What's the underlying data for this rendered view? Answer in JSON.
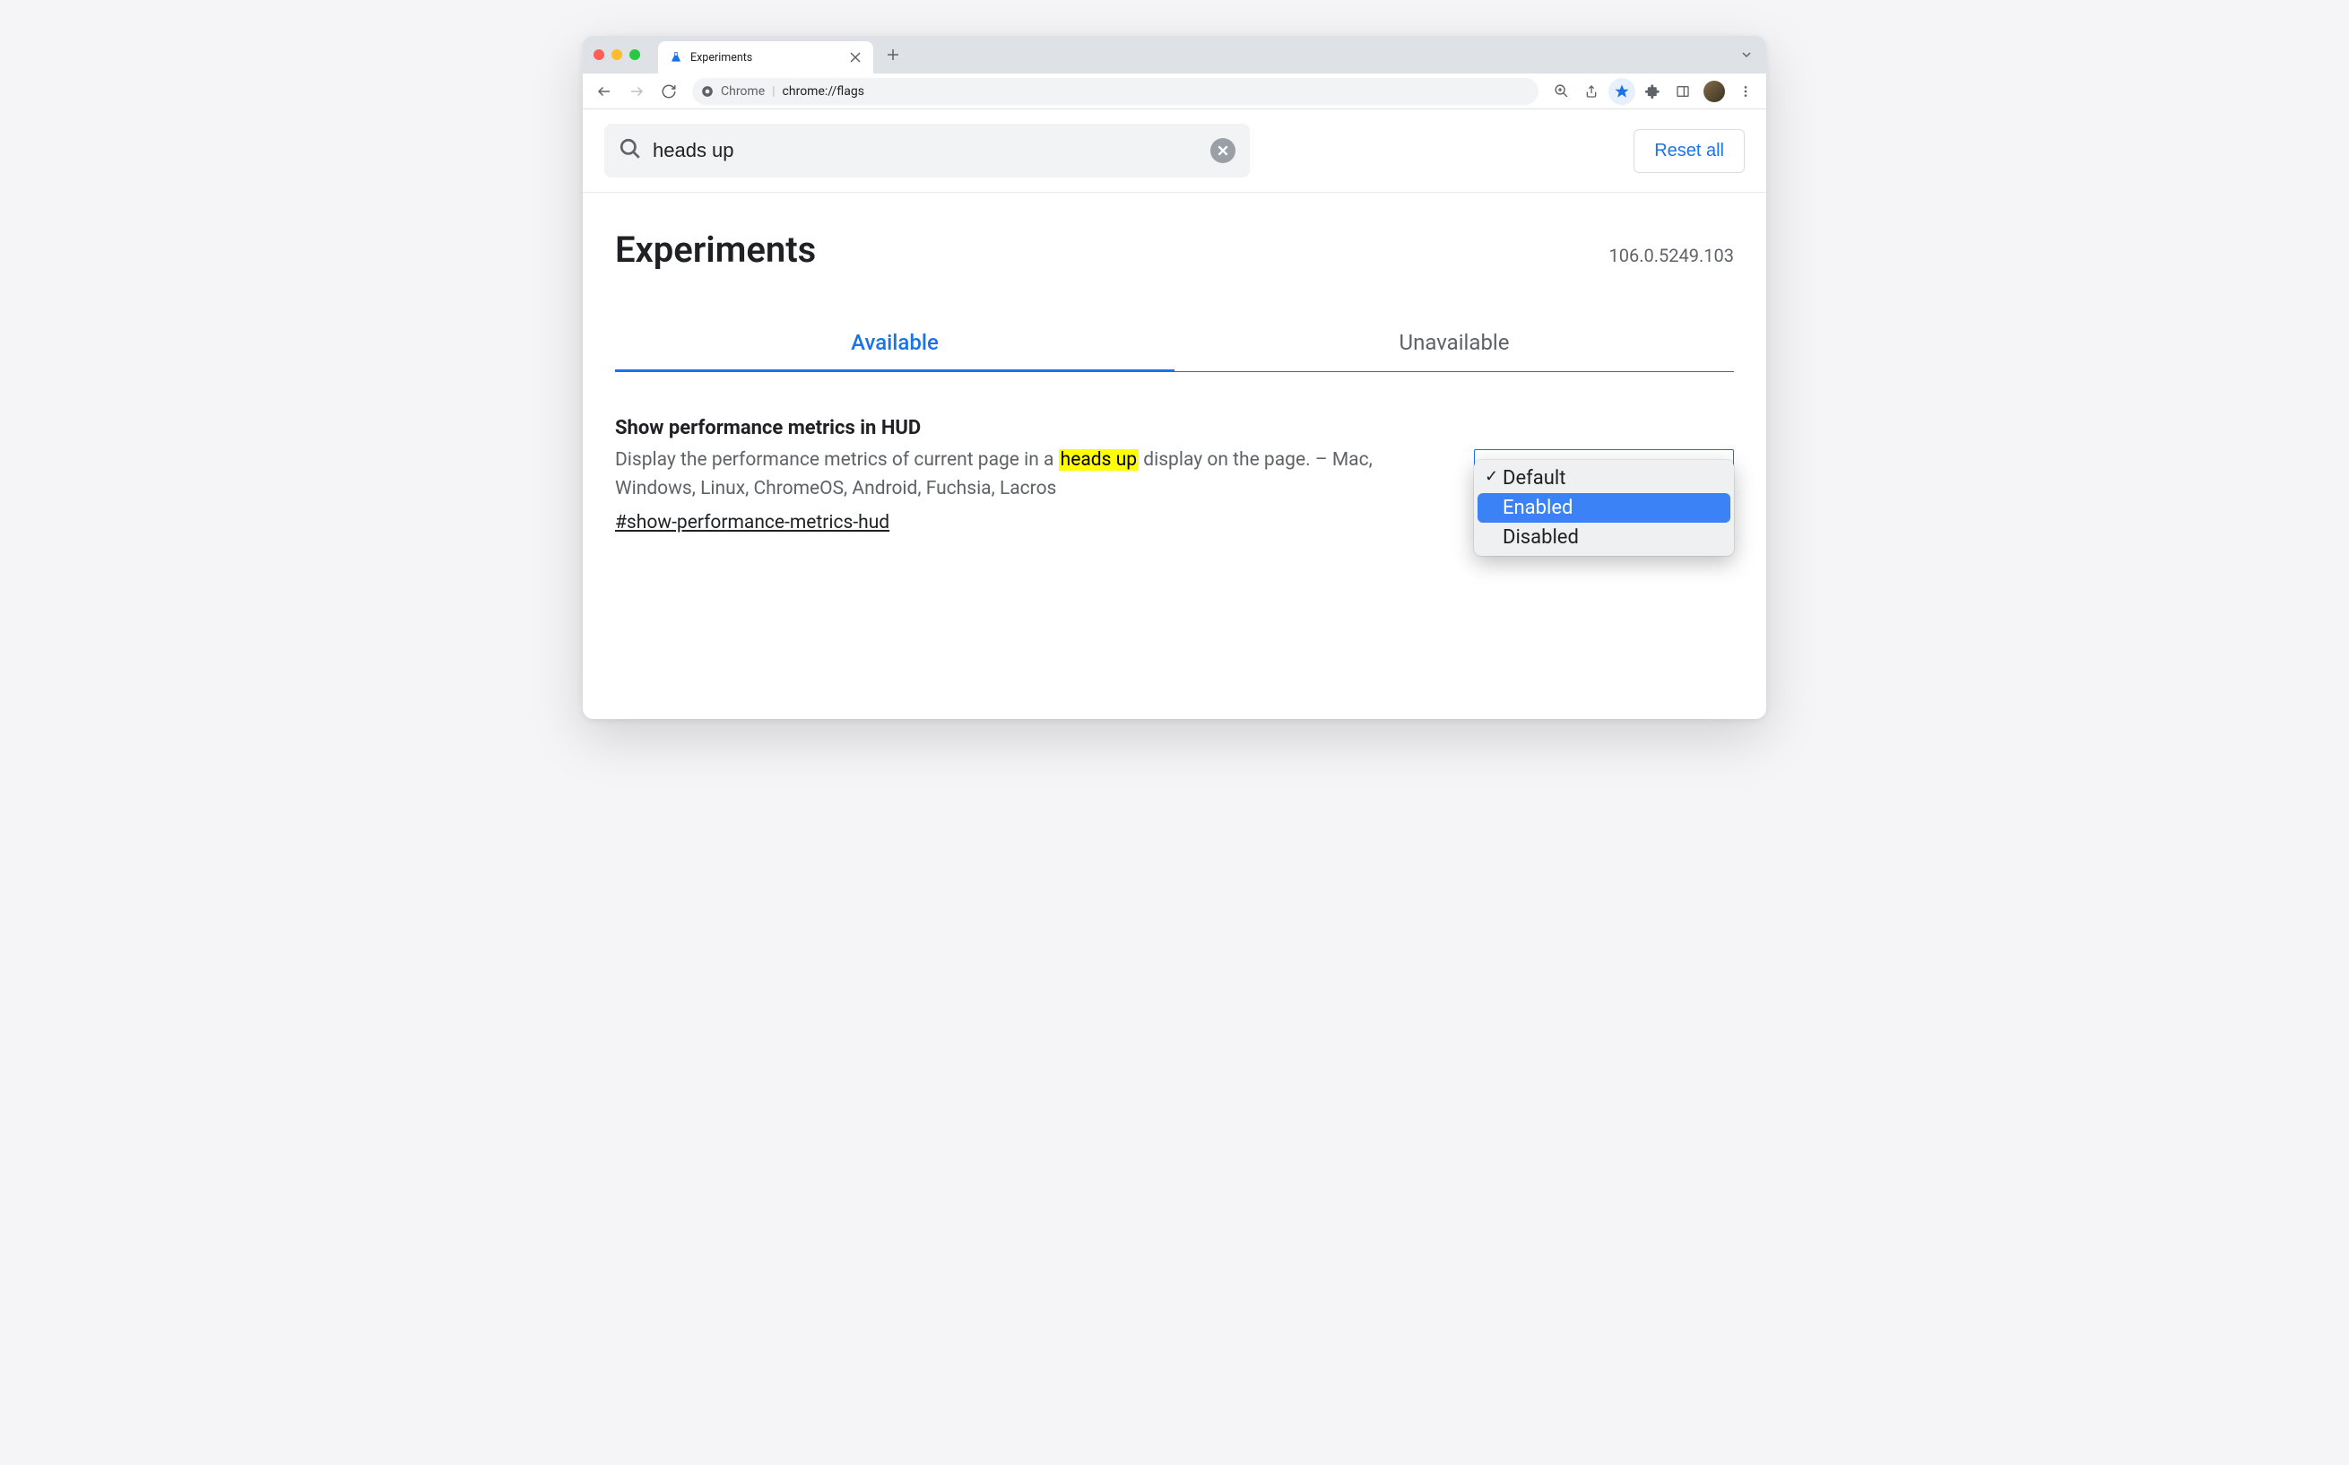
{
  "window": {
    "tab": {
      "title": "Experiments"
    }
  },
  "toolbar": {
    "omnibox_label": "Chrome",
    "omnibox_url": "chrome://flags"
  },
  "search": {
    "value": "heads up",
    "reset_label": "Reset all"
  },
  "header": {
    "title": "Experiments",
    "version": "106.0.5249.103"
  },
  "tabs": {
    "available": "Available",
    "unavailable": "Unavailable"
  },
  "experiment": {
    "title": "Show performance metrics in HUD",
    "desc_before": "Display the performance metrics of current page in a ",
    "desc_highlight": "heads up",
    "desc_after": " display on the page. – Mac, Windows, Linux, ChromeOS, Android, Fuchsia, Lacros",
    "hash": "#show-performance-metrics-hud"
  },
  "dropdown": {
    "options": {
      "default": "Default",
      "enabled": "Enabled",
      "disabled": "Disabled"
    }
  }
}
